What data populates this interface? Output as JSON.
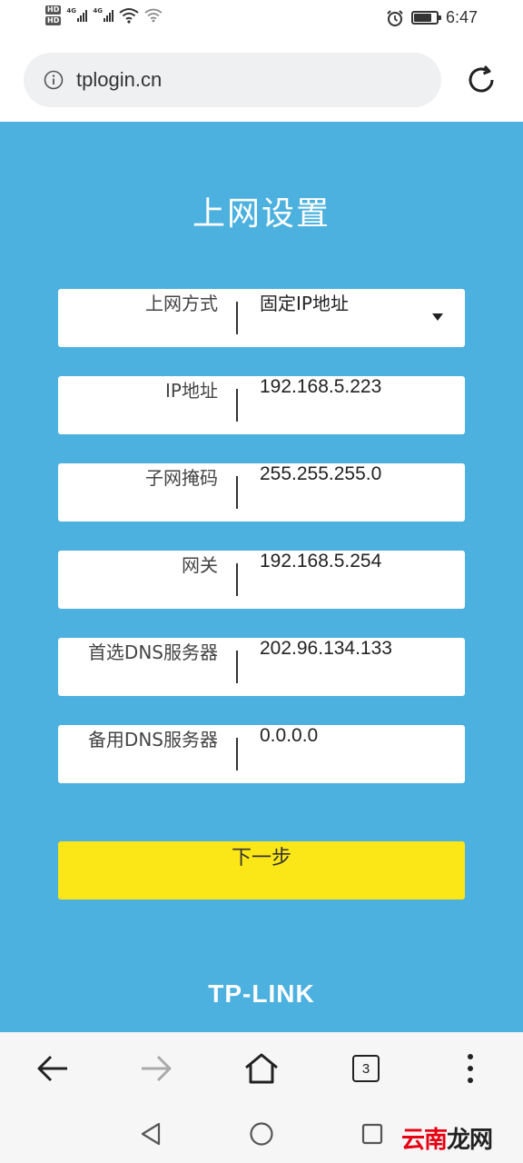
{
  "status_bar": {
    "hd_labels": [
      "HD",
      "HD"
    ],
    "network_labels": [
      "4G",
      "4G"
    ],
    "time": "6:47",
    "battery_level": 0.8,
    "icons": [
      "hd-icon",
      "signal-icon",
      "wifi-icon",
      "alarm-icon",
      "battery-icon"
    ]
  },
  "browser": {
    "url": "tplogin.cn",
    "tab_count": "3",
    "icons": [
      "info-icon",
      "reload-icon",
      "back-icon",
      "forward-icon",
      "home-icon",
      "tabs-icon",
      "more-icon"
    ]
  },
  "page": {
    "title": "上网设置",
    "fields": [
      {
        "label": "上网方式",
        "value": "固定IP地址",
        "type": "select"
      },
      {
        "label": "IP地址",
        "value": "192.168.5.223",
        "type": "text"
      },
      {
        "label": "子网掩码",
        "value": "255.255.255.0",
        "type": "text"
      },
      {
        "label": "网关",
        "value": "192.168.5.254",
        "type": "text"
      },
      {
        "label": "首选DNS服务器",
        "value": "202.96.134.133",
        "type": "text"
      },
      {
        "label": "备用DNS服务器",
        "value": "0.0.0.0",
        "type": "text"
      }
    ],
    "next_button": "下一步",
    "brand": "TP-LINK"
  },
  "watermark": {
    "part1": "云南",
    "part2": "龙网"
  },
  "colors": {
    "panel_blue": "#4cb1de",
    "button_yellow": "#fbe617",
    "watermark_red": "#e60012"
  }
}
